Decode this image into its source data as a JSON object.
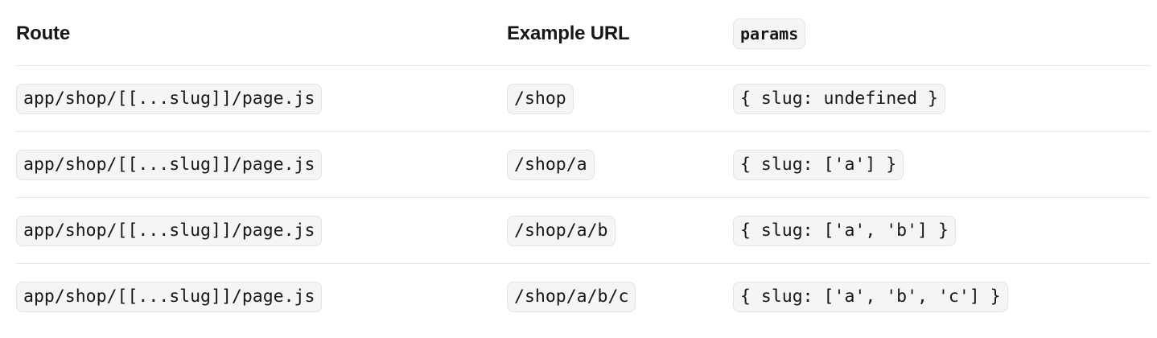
{
  "table": {
    "headers": {
      "route": "Route",
      "example_url": "Example URL",
      "params": "params"
    },
    "rows": [
      {
        "route": "app/shop/[[...slug]]/page.js",
        "url": "/shop",
        "params": "{ slug: undefined }"
      },
      {
        "route": "app/shop/[[...slug]]/page.js",
        "url": "/shop/a",
        "params": "{ slug: ['a'] }"
      },
      {
        "route": "app/shop/[[...slug]]/page.js",
        "url": "/shop/a/b",
        "params": "{ slug: ['a', 'b'] }"
      },
      {
        "route": "app/shop/[[...slug]]/page.js",
        "url": "/shop/a/b/c",
        "params": "{ slug: ['a', 'b', 'c'] }"
      }
    ]
  }
}
